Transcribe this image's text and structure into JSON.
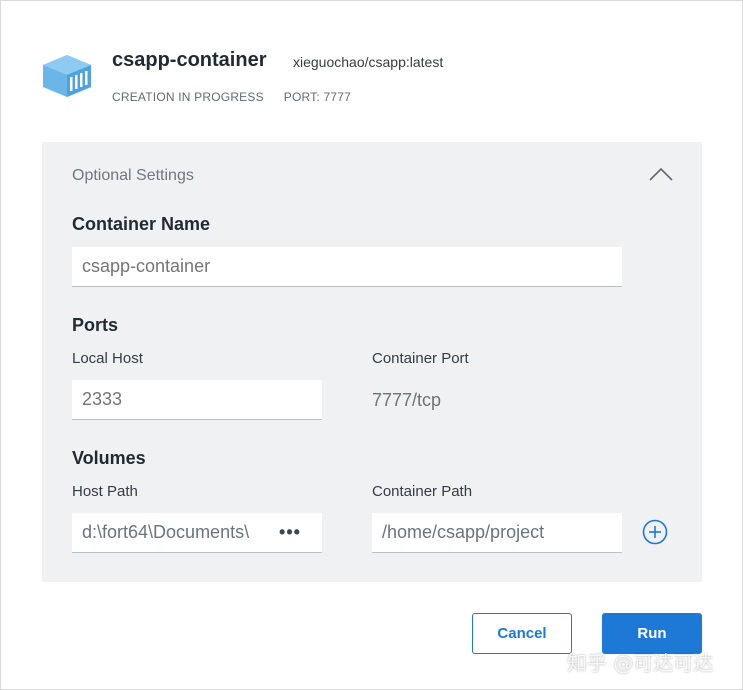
{
  "header": {
    "logo_icon": "docker-container-icon",
    "title": "csapp-container",
    "image": "xieguochao/csapp:latest",
    "status": "CREATION IN PROGRESS",
    "port": "PORT: 7777"
  },
  "optional_settings": {
    "title": "Optional Settings",
    "collapse_icon": "chevron-up-icon",
    "container_name": {
      "label": "Container Name",
      "placeholder": "csapp-container"
    },
    "ports": {
      "label": "Ports",
      "local_host_label": "Local Host",
      "local_host_placeholder": "2333",
      "container_port_label": "Container Port",
      "container_port_value": "7777/tcp"
    },
    "volumes": {
      "label": "Volumes",
      "host_path_label": "Host Path",
      "host_path_value": "d:\\fort64\\Documents\\",
      "more_label": "•••",
      "container_path_label": "Container Path",
      "container_path_value": "/home/csapp/project",
      "add_icon": "plus-circle-icon"
    }
  },
  "actions": {
    "cancel_label": "Cancel",
    "run_label": "Run"
  },
  "watermark": "知乎 @可达可达",
  "colors": {
    "accent": "#1d78d6",
    "logo": "#6bb6e8",
    "panel_bg": "#f0f1f2"
  }
}
